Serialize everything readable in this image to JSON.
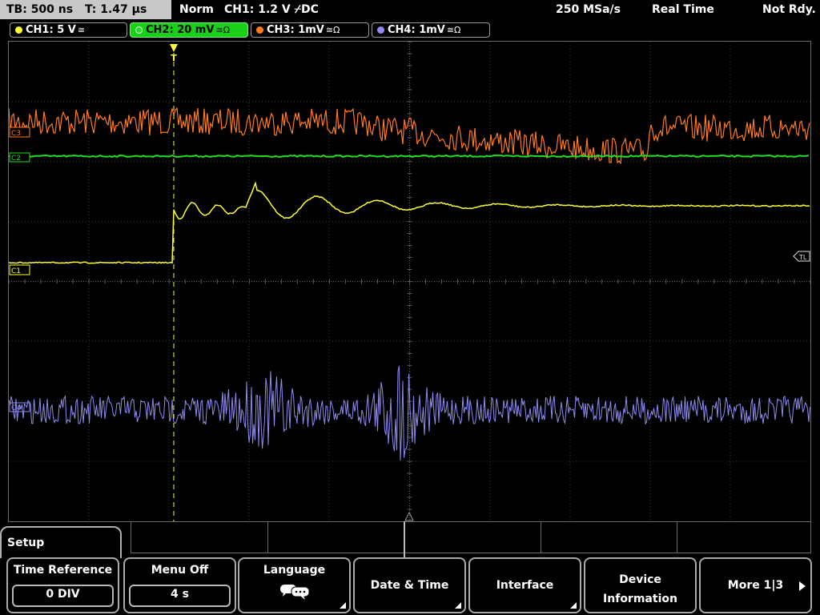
{
  "status": {
    "timebase": "TB: 500 ns",
    "trigger_time": "T: 1.47 µs",
    "mode": "Norm",
    "trigger_info": "CH1: 1.2 V ⌿DC",
    "sample_rate": "250 MSa/s",
    "acq_mode": "Real Time",
    "state": "Not Rdy."
  },
  "channels": [
    {
      "label": "CH1: 5 V",
      "coupling": "≅",
      "color": "#ffff30"
    },
    {
      "label": "CH2: 20 mV",
      "coupling": "≅Ω",
      "color": "#20e020"
    },
    {
      "label": "CH3: 1mV",
      "coupling": "≅Ω",
      "color": "#ff7a20"
    },
    {
      "label": "CH4: 1mV",
      "coupling": "≅Ω",
      "color": "#8e8cf0"
    }
  ],
  "markers": {
    "c3": "C3",
    "c2": "C2",
    "c1": "C1",
    "c4": "C4",
    "tl": "TL",
    "trigger": "T"
  },
  "menu": {
    "title": "Setup",
    "softkeys": [
      {
        "label": "Time Reference",
        "value": "0 DIV"
      },
      {
        "label": "Menu Off",
        "value": "4 s"
      },
      {
        "label": "Language",
        "icon": "speech-bubbles-icon"
      },
      {
        "label": "Date & Time"
      },
      {
        "label": "Interface"
      },
      {
        "label": "Device Information"
      },
      {
        "label": "More 1|3"
      }
    ]
  }
}
